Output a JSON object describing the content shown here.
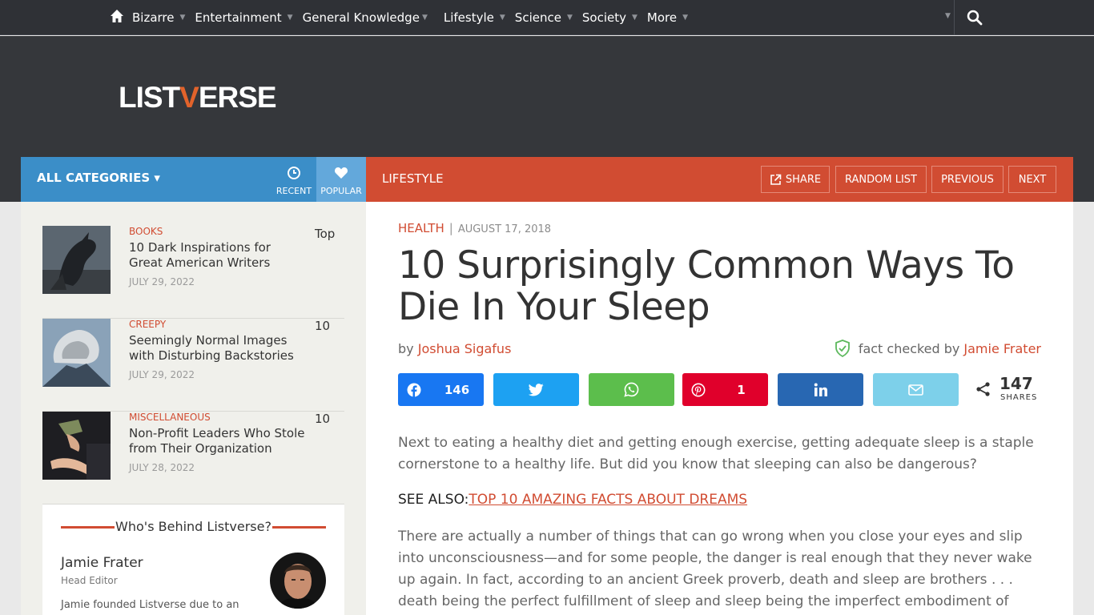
{
  "topnav": {
    "items": [
      {
        "label": "Bizarre"
      },
      {
        "label": "Entertainment"
      },
      {
        "label": "General Knowledge"
      },
      {
        "label": "Lifestyle"
      },
      {
        "label": "Science"
      },
      {
        "label": "Society"
      },
      {
        "label": "More"
      }
    ]
  },
  "logo": {
    "part1": "LIST",
    "v": "V",
    "part2": "ERSE"
  },
  "catbar": {
    "all_categories": "ALL CATEGORIES ▾",
    "recent": "RECENT",
    "popular": "POPULAR"
  },
  "lifebar": {
    "section": "LIFESTYLE",
    "share": "SHARE",
    "random": "RANDOM LIST",
    "previous": "PREVIOUS",
    "next": "NEXT"
  },
  "sidebar": {
    "items": [
      {
        "category": "BOOKS",
        "title": "10 Dark Inspirations for Great American Writers",
        "date": "JULY 29, 2022",
        "rank": "Top"
      },
      {
        "category": "CREEPY",
        "title": "Seemingly Normal Images with Disturbing Backstories",
        "date": "JULY 29, 2022",
        "rank": "10"
      },
      {
        "category": "MISCELLANEOUS",
        "title": "Non-Profit Leaders Who Stole from Their Organization",
        "date": "JULY 28, 2022",
        "rank": "10"
      }
    ],
    "who": {
      "title": "Who's Behind Listverse?",
      "name": "Jamie Frater",
      "role": "Head Editor",
      "bio": "Jamie founded Listverse due to an"
    }
  },
  "article": {
    "category": "HEALTH",
    "date": "AUGUST 17, 2018",
    "title": "10 Surprisingly Common Ways To Die In Your Sleep",
    "by": "by",
    "author": "Joshua Sigafus",
    "fact_prefix": "fact checked by",
    "fact_checker": "Jamie Frater",
    "share": {
      "facebook": "146",
      "pinterest": "1",
      "total": "147",
      "total_label": "SHARES",
      "colors": {
        "facebook": "#1877f2",
        "twitter": "#1da1f2",
        "whatsapp": "#5cbe4c",
        "pinterest": "#e0002b",
        "linkedin": "#2867b2",
        "email": "#7dd0ea"
      }
    },
    "para1": "Next to eating a healthy diet and getting enough exercise, getting adequate sleep is a staple cornerstone to a healthy life. But did you know that sleeping can also be dangerous?",
    "see_also_label": "SEE ALSO:",
    "see_also_link": "TOP 10 AMAZING FACTS ABOUT DREAMS",
    "para2": "There are actually a number of things that can go wrong when you close your eyes and slip into unconsciousness—and for some people, the danger is real enough that they never wake up again. In fact, according to an ancient Greek proverb, death and sleep are brothers . . . death being the perfect fulfillment of sleep and sleep being the imperfect embodiment of death."
  }
}
